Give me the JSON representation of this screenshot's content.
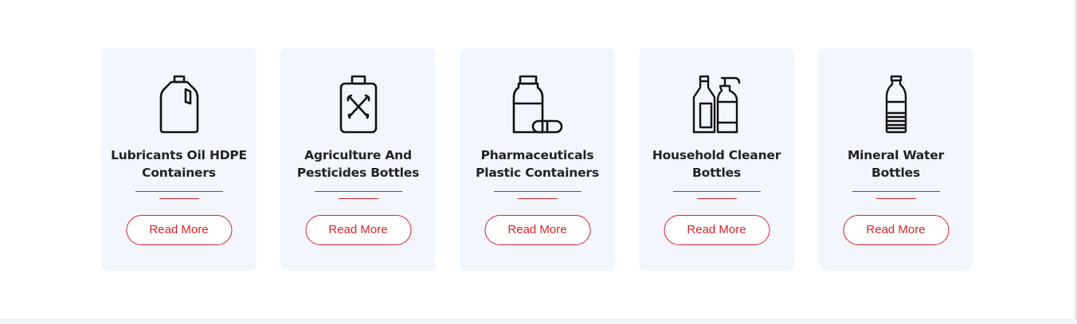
{
  "colors": {
    "accent": "#d9252b",
    "card_bg": "#f3f7fd",
    "text": "#222222"
  },
  "cards": [
    {
      "icon": "gallon-jug-icon",
      "title_line1": "Lubricants Oil HDPE",
      "title_line2": "Containers",
      "button": "Read More"
    },
    {
      "icon": "pesticide-bottle-icon",
      "title_line1": "Agriculture And",
      "title_line2": "Pesticides Bottles",
      "button": "Read More"
    },
    {
      "icon": "medicine-bottle-capsule-icon",
      "title_line1": "Pharmaceuticals",
      "title_line2": "Plastic Containers",
      "button": "Read More"
    },
    {
      "icon": "cleaner-pump-bottles-icon",
      "title_line1": "Household Cleaner",
      "title_line2": "Bottles",
      "button": "Read More"
    },
    {
      "icon": "water-bottle-icon",
      "title_line1": "Mineral Water",
      "title_line2": "Bottles",
      "button": "Read More"
    }
  ]
}
